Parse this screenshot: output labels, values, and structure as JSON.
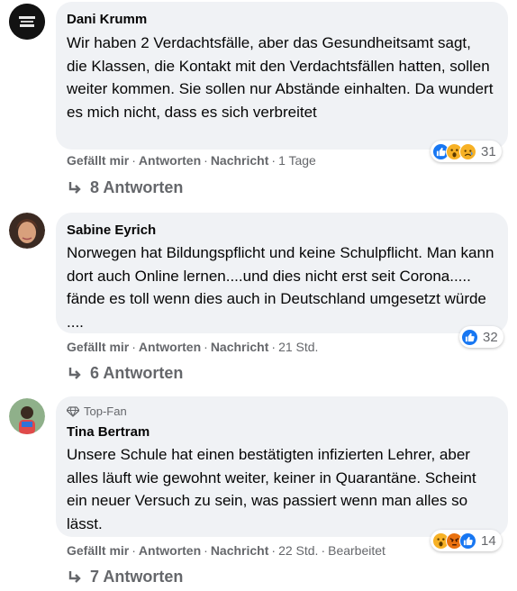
{
  "comments": [
    {
      "author": "Dani Krumm",
      "text": "Wir haben 2 Verdachtsfälle, aber das Gesundheitsamt sagt, die Klassen, die Kontakt mit den Verdachtsfällen hatten, sollen weiter kommen. Sie sollen nur Abstände einhalten. Da wundert es mich nicht, dass es sich verbreitet",
      "like": "Gefällt mir",
      "reply": "Antworten",
      "message": "Nachricht",
      "time": "1 Tage",
      "reaction_count": "31",
      "reactions": [
        "like-icon",
        "wow-icon",
        "sad-icon"
      ],
      "replies": "8 Antworten"
    },
    {
      "author": "Sabine Eyrich",
      "text": "Norwegen hat Bildungspflicht und keine Schulpflicht. Man kann dort auch Online lernen....und dies nicht erst seit Corona..... fände es toll wenn dies auch in Deutschland umgesetzt würde ....",
      "like": "Gefällt mir",
      "reply": "Antworten",
      "message": "Nachricht",
      "time": "21 Std.",
      "reaction_count": "32",
      "reactions": [
        "like-icon"
      ],
      "replies": "6 Antworten"
    },
    {
      "badge": "Top-Fan",
      "author": "Tina Bertram",
      "text": "Unsere Schule hat einen bestätigten infizierten Lehrer, aber alles läuft wie gewohnt weiter, keiner in Quarantäne. Scheint ein neuer Versuch zu sein, was passiert wenn man alles so lässt.",
      "like": "Gefällt mir",
      "reply": "Antworten",
      "message": "Nachricht",
      "time": "22 Std.",
      "edited": "Bearbeitet",
      "reaction_count": "14",
      "reactions": [
        "wow-icon",
        "angry-icon",
        "like-icon"
      ],
      "replies": "7 Antworten"
    }
  ],
  "colors": {
    "bubble": "#f0f2f5",
    "meta": "#65676b",
    "like_blue": "#1877f2",
    "wow_yellow": "#f7b125",
    "angry_orange": "#e9710f"
  }
}
